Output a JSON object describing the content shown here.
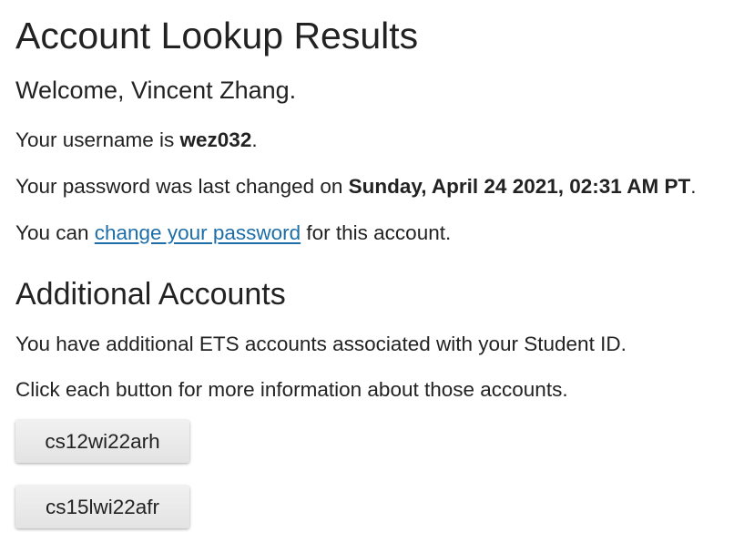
{
  "page": {
    "title": "Account Lookup Results",
    "welcome": "Welcome, Vincent Zhang."
  },
  "account": {
    "username_prefix": "Your username is ",
    "username": "wez032",
    "username_suffix": ".",
    "password_prefix": "Your password was last changed on ",
    "password_changed": "Sunday, April 24 2021, 02:31 AM PT",
    "password_suffix": ".",
    "change_prefix": "You can ",
    "change_link": "change your password",
    "change_suffix": " for this account."
  },
  "additional": {
    "heading": "Additional Accounts",
    "intro": "You have additional ETS accounts associated with your Student ID.",
    "instruction": "Click each button for more information about those accounts.",
    "buttons": [
      {
        "label": "cs12wi22arh"
      },
      {
        "label": "cs15lwi22afr"
      }
    ]
  }
}
